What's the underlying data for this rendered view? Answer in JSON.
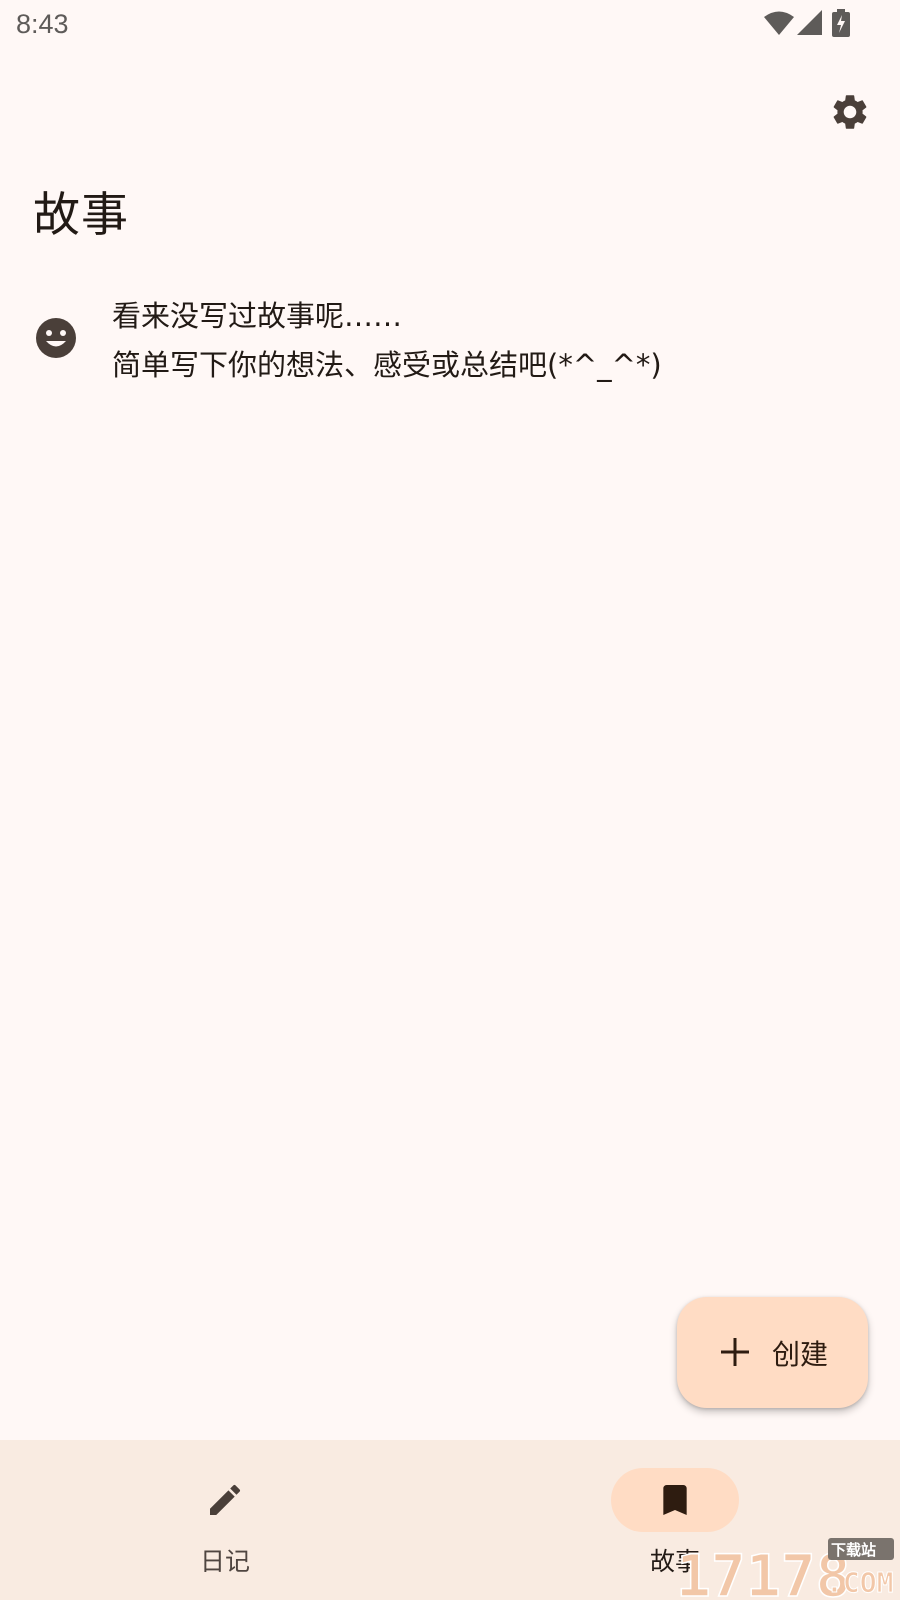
{
  "status_bar": {
    "time": "8:43",
    "icons": [
      "wifi-icon",
      "signal-icon",
      "battery-charging-icon"
    ]
  },
  "header": {
    "title": "故事",
    "settings_icon": "gear-icon"
  },
  "empty_state": {
    "icon": "smiley-icon",
    "line1": "看来没写过故事呢……",
    "line2": "简单写下你的想法、感受或总结吧(*^_^*)"
  },
  "fab": {
    "icon": "plus-icon",
    "label": "创建"
  },
  "bottom_nav": {
    "items": [
      {
        "label": "日记",
        "icon": "pencil-icon",
        "selected": false
      },
      {
        "label": "故事",
        "icon": "bookmark-icon",
        "selected": true
      }
    ]
  },
  "watermark": {
    "text": "17178",
    "suffix": ".COM",
    "badge": "下载站"
  },
  "colors": {
    "background": "#fff8f6",
    "nav_background": "#f9ebe1",
    "accent_container": "#ffdcc4",
    "icon": "#4a3f39",
    "text": "#221a15"
  }
}
